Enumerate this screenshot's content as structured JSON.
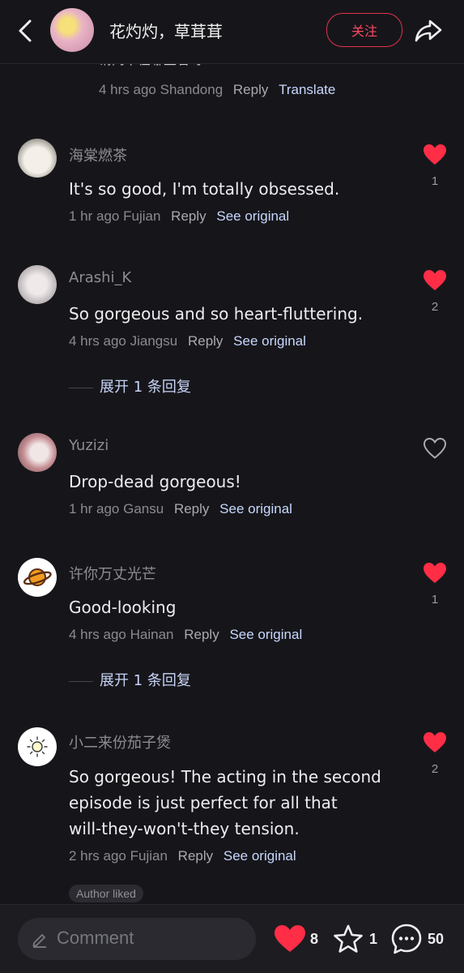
{
  "header": {
    "title": "花灼灼，草茸茸",
    "follow_label": "关注"
  },
  "partial_comment": {
    "text": "请问下在哪里看呀",
    "time": "4 hrs ago",
    "location": "Shandong",
    "reply": "Reply",
    "action": "Translate"
  },
  "comments": [
    {
      "username": "海棠燃茶",
      "text": "It's so good, I'm totally obsessed.",
      "time": "1 hr ago",
      "location": "Fujian",
      "reply": "Reply",
      "action": "See original",
      "likes": "1",
      "liked": true
    },
    {
      "username": "Arashi_K",
      "text": "So gorgeous and so heart-fluttering.",
      "time": "4 hrs ago",
      "location": "Jiangsu",
      "reply": "Reply",
      "action": "See original",
      "likes": "2",
      "liked": true,
      "expand": "展开 1 条回复"
    },
    {
      "username": "Yuzizi",
      "text": "Drop-dead gorgeous!",
      "time": "1 hr ago",
      "location": "Gansu",
      "reply": "Reply",
      "action": "See original",
      "likes": "",
      "liked": false
    },
    {
      "username": "许你万丈光芒",
      "text": "Good-looking",
      "time": "4 hrs ago",
      "location": "Hainan",
      "reply": "Reply",
      "action": "See original",
      "likes": "1",
      "liked": true,
      "expand": "展开 1 条回复"
    },
    {
      "username": "小二来份茄子煲",
      "text_lines": [
        "So gorgeous! The acting in the second",
        "episode is just perfect for all that",
        "will-they-won't-they tension."
      ],
      "time": "2 hrs ago",
      "location": "Fujian",
      "reply": "Reply",
      "action": "See original",
      "likes": "2",
      "liked": true,
      "badge": "Author liked"
    }
  ],
  "bottom_bar": {
    "comment_placeholder": "Comment",
    "likes_count": "8",
    "favorites_count": "1",
    "comments_count": "50"
  },
  "colors": {
    "background": "#16161a",
    "accent_red": "#ff2d46",
    "link_blue": "#c8d7ff"
  }
}
